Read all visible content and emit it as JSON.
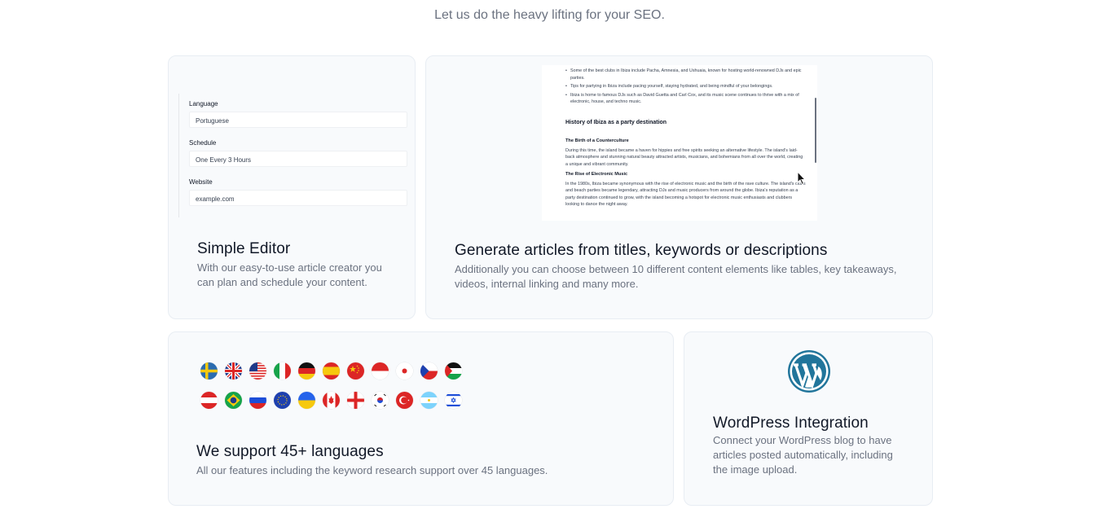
{
  "header": {
    "tagline": "Let us do the heavy lifting for your SEO."
  },
  "simple_editor": {
    "title": "Simple Editor",
    "description": "With our easy-to-use article creator you can plan and schedule your content.",
    "fields": [
      {
        "label": "Language",
        "value": "Portuguese"
      },
      {
        "label": "Schedule",
        "value": "One Every 3 Hours"
      },
      {
        "label": "Website",
        "value": "example.com"
      }
    ]
  },
  "generate": {
    "title": "Generate articles from titles, keywords or descriptions",
    "description": "Additionally you can choose between 10 different content elements like tables, key takeaways, videos, internal linking and many more.",
    "preview": {
      "bullets": [
        "Some of the best clubs in Ibiza include Pacha, Amnesia, and Ushuaia, known for hosting world-renowned DJs and epic parties.",
        "Tips for partying in Ibiza include pacing yourself, staying hydrated, and being mindful of your belongings.",
        "Ibiza is home to famous DJs such as David Guetta and Carl Cox, and its music scene continues to thrive with a mix of electronic, house, and techno music."
      ],
      "heading": "History of Ibiza as a party destination",
      "sections": [
        {
          "subheading": "The Birth of a Counterculture",
          "text": "During this time, the island became a haven for hippies and free spirits seeking an alternative lifestyle. The island's laid-back atmosphere and stunning natural beauty attracted artists, musicians, and bohemians from all over the world, creating a unique and vibrant community."
        },
        {
          "subheading": "The Rise of Electronic Music",
          "text": "In the 1980s, Ibiza became synonymous with the rise of electronic music and the birth of the rave culture. The island's clubs and beach parties became legendary, attracting DJs and music producers from around the globe. Ibiza's reputation as a party destination continued to grow, with the island becoming a hotspot for electronic music enthusiasts and clubbers looking to dance the night away."
        }
      ]
    }
  },
  "languages": {
    "title": "We support 45+ languages",
    "description": "All our features including the keyword research support over 45 languages.",
    "flags": [
      "sweden",
      "united-kingdom",
      "united-states",
      "italy",
      "germany",
      "spain",
      "china",
      "indonesia",
      "japan",
      "czech-republic",
      "palestine",
      "austria",
      "brazil",
      "russia",
      "european-union",
      "ukraine",
      "canada",
      "england",
      "south-korea",
      "turkey",
      "argentina",
      "israel"
    ]
  },
  "wordpress": {
    "title": "WordPress Integration",
    "description": "Connect your WordPress blog to have articles posted automatically, including the image upload.",
    "icon": "wordpress-logo-icon",
    "brand_color": "#21759b"
  }
}
